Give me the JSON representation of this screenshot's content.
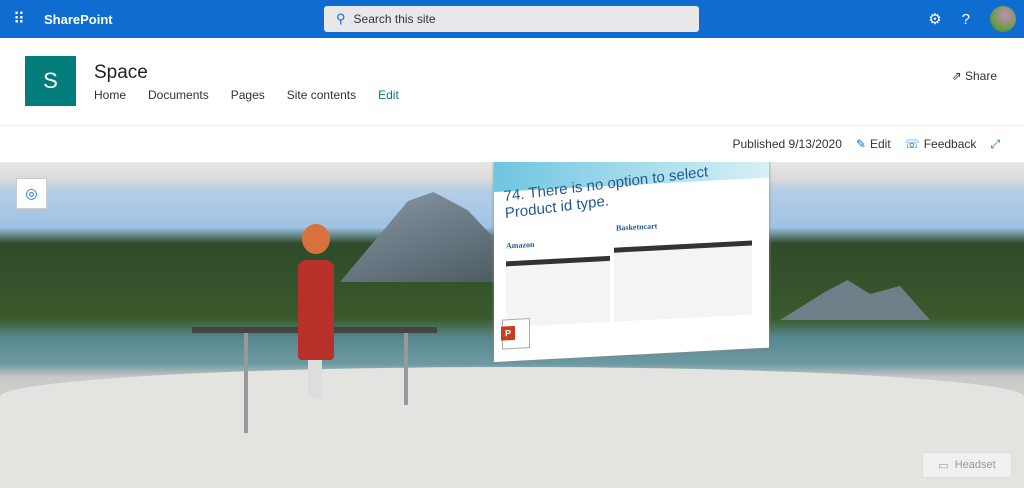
{
  "topbar": {
    "app_name": "SharePoint",
    "search_placeholder": "Search this site"
  },
  "site": {
    "logo_letter": "S",
    "title": "Space",
    "nav": [
      "Home",
      "Documents",
      "Pages",
      "Site contents",
      "Edit"
    ],
    "share": "Share"
  },
  "commandbar": {
    "published": "Published 9/13/2020",
    "edit": "Edit",
    "feedback": "Feedback"
  },
  "scene": {
    "slide_title": "74. There is no option to select Product id type.",
    "label_left": "Amazon",
    "label_right": "Basketncart",
    "headset": "Headset"
  }
}
